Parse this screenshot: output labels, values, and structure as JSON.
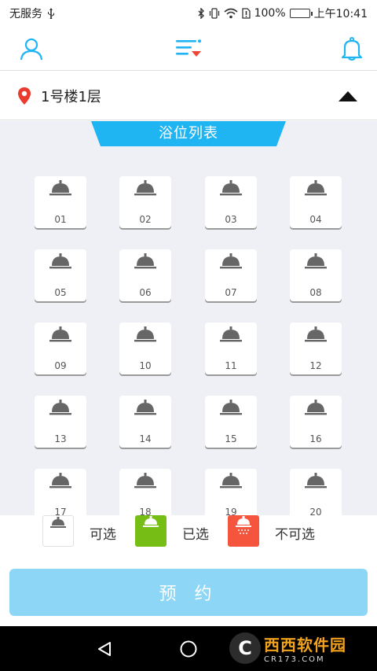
{
  "status_bar": {
    "carrier": "无服务",
    "battery_percent": "100%",
    "time": "上午10:41"
  },
  "header": {
    "icons": [
      "user-icon",
      "filter-menu-icon",
      "bell-icon"
    ]
  },
  "location": {
    "name": "1号楼1层",
    "icon": "location-pin-icon"
  },
  "list": {
    "title": "浴位列表",
    "stalls": [
      "01",
      "02",
      "03",
      "04",
      "05",
      "06",
      "07",
      "08",
      "09",
      "10",
      "11",
      "12",
      "13",
      "14",
      "15",
      "16",
      "17",
      "18",
      "19",
      "20"
    ]
  },
  "legend": {
    "available": "可选",
    "selected": "已选",
    "unavailable": "不可选"
  },
  "actions": {
    "book": "预 约"
  },
  "watermark": {
    "main": "西西软件园",
    "sub": "CR173.COM"
  },
  "colors": {
    "accent": "#1fb4f2",
    "selected_green": "#76be16",
    "unavailable_red": "#f4553c",
    "book_button": "#8ed6f6",
    "shower_gray": "#666666"
  }
}
